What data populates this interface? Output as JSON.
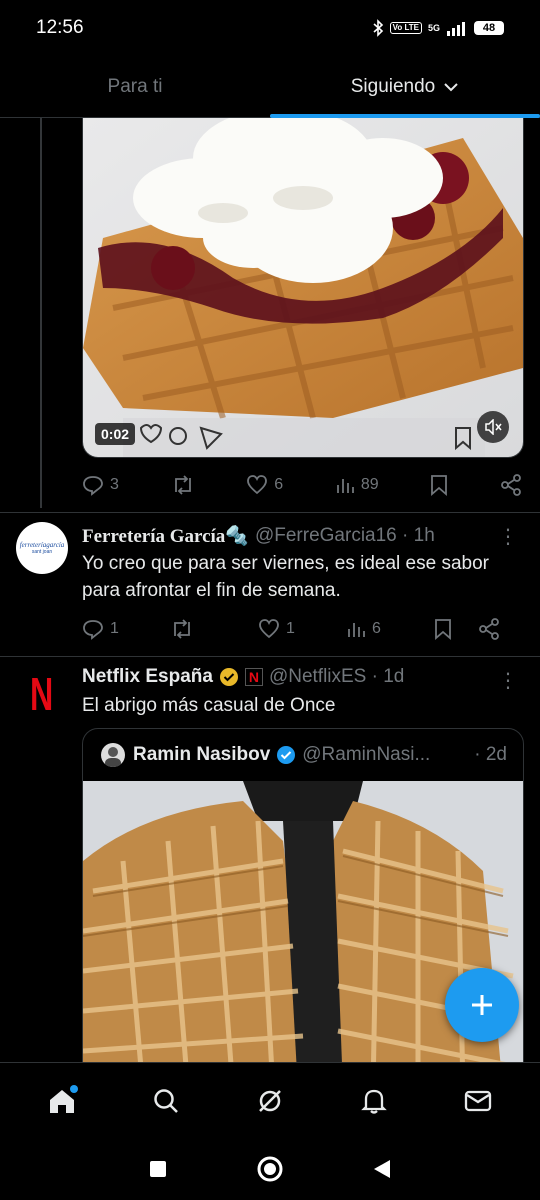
{
  "status_bar": {
    "time": "12:56",
    "network": "5G",
    "volte": "Vo LTE",
    "battery": "48"
  },
  "tabs": [
    {
      "label": "Para ti",
      "active": false
    },
    {
      "label": "Siguiendo",
      "active": true
    }
  ],
  "post1": {
    "video_timer": "0:02",
    "replies": "3",
    "retweets": "",
    "likes": "6",
    "views": "89"
  },
  "post2": {
    "avatar_text": "ferreteríagarcía",
    "avatar_sub": "sant joan",
    "name": "Ferretería García🔩",
    "handle": "@FerreGarcia16 · 1h",
    "text": "Yo creo que para ser viernes, es ideal ese sabor para afrontar el fin de semana.",
    "replies": "1",
    "likes": "1",
    "views": "6"
  },
  "post3": {
    "avatar_text": "N",
    "name": "Netflix España",
    "handle": "@NetflixES · 1d",
    "text": "El abrigo más casual de Once",
    "quote": {
      "name": "Ramin Nasibov",
      "handle": "@RaminNasi...",
      "time": "· 2d"
    }
  },
  "colors": {
    "accent": "#1d9bf0",
    "muted": "#71767b",
    "netflix": "#e50914",
    "verified_gold": "#e8b829"
  }
}
